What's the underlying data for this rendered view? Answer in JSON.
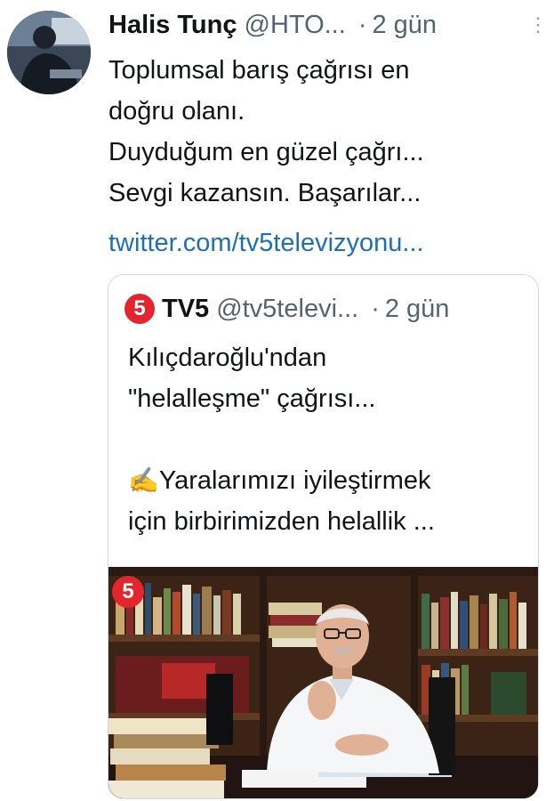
{
  "tweet": {
    "author_name": "Halis Tunç",
    "author_handle": "@HTO...",
    "dot": "·",
    "time": "2 gün",
    "more_icon": "⋮",
    "lines": [
      "Toplumsal barış çağrısı en",
      "doğru olanı.",
      "Duyduğum en güzel çağrı...",
      "Sevgi kazansın. Başarılar..."
    ],
    "link": "twitter.com/tv5televizyonu..."
  },
  "quote": {
    "logo": "5",
    "name": "TV5",
    "handle": "@tv5televi...",
    "dot": "·",
    "time": "2 gün",
    "lines": [
      "Kılıçdaroğlu'ndan",
      "\"helalleşme\" çağrısı...",
      "",
      "Yaralarımızı iyileştirmek",
      "için birbirimizden helallik ..."
    ],
    "emoji": "✍️",
    "media_logo": "5"
  },
  "colors": {
    "text": "#0f1419",
    "secondary": "#536471",
    "link": "#1d6fb8",
    "brand_red": "#e3262e",
    "border": "#cfd9de"
  },
  "icons": {
    "avatar": "avatar-photo",
    "more": "more-options-icon",
    "logo": "tv5-logo"
  }
}
